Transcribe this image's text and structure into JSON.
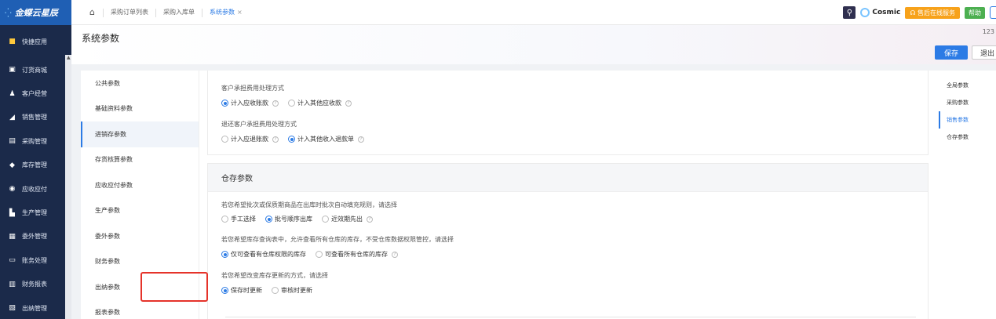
{
  "app": {
    "logo_text": "金蝶云星辰"
  },
  "tabs": [
    {
      "label": "采购订单列表"
    },
    {
      "label": "采购入库单"
    },
    {
      "label": "系统参数"
    }
  ],
  "top_right": {
    "cosmic_label": "Cosmic",
    "service_label": "售后在线服务",
    "help_label": "帮助"
  },
  "sidebar": {
    "items": [
      {
        "label": "快捷应用",
        "icon": "grid-icon"
      },
      {
        "label": "订货商城",
        "icon": "bag-icon"
      },
      {
        "label": "客户经营",
        "icon": "customers-icon"
      },
      {
        "label": "销售管理",
        "icon": "sales-icon"
      },
      {
        "label": "采购管理",
        "icon": "cart-icon"
      },
      {
        "label": "库存管理",
        "icon": "cube-icon"
      },
      {
        "label": "应收应付",
        "icon": "receivable-icon"
      },
      {
        "label": "生产管理",
        "icon": "factory-icon"
      },
      {
        "label": "委外管理",
        "icon": "outsource-icon"
      },
      {
        "label": "账务处理",
        "icon": "ledger-icon"
      },
      {
        "label": "财务报表",
        "icon": "report-icon"
      },
      {
        "label": "出纳管理",
        "icon": "cashier-icon"
      }
    ]
  },
  "header": {
    "title": "系统参数",
    "page_num": "123",
    "save_label": "保存",
    "exit_label": "退出"
  },
  "left_nav": {
    "items": [
      {
        "label": "公共参数"
      },
      {
        "label": "基础资料参数"
      },
      {
        "label": "进销存参数",
        "active": true
      },
      {
        "label": "存货核算参数"
      },
      {
        "label": "应收应付参数"
      },
      {
        "label": "生产参数"
      },
      {
        "label": "委外参数"
      },
      {
        "label": "财务参数"
      },
      {
        "label": "出纳参数"
      },
      {
        "label": "报表参数"
      }
    ]
  },
  "section1": {
    "q1": {
      "label": "客户承担费用处理方式",
      "opt_a": "计入应收账款",
      "opt_b": "计入其他应收款",
      "selected": "opt_a"
    },
    "q2": {
      "label": "退还客户承担费用处理方式",
      "opt_a": "计入应退账款",
      "opt_b": "计入其他收入退款单",
      "selected": "opt_b"
    }
  },
  "section2": {
    "title": "仓存参数",
    "q1": {
      "label": "若您希望批次或保质期商品在出库时批次自动填充规则，请选择",
      "opt_a": "手工选择",
      "opt_b": "批号顺序出库",
      "opt_c": "近效期先出",
      "selected": "opt_b"
    },
    "q2": {
      "label": "若您希望库存查询表中，允许查看所有仓库的库存，不受仓库数据权限管控，请选择",
      "opt_a": "仅可查看有仓库权限的库存",
      "opt_b": "可查看所有仓库的库存",
      "selected": "opt_a"
    },
    "q3": {
      "label": "若您希望改变库存更新的方式，请选择",
      "opt_a": "保存时更新",
      "opt_b": "审核时更新",
      "selected": "opt_a"
    }
  },
  "anchor": {
    "items": [
      {
        "label": "全局参数"
      },
      {
        "label": "采购参数"
      },
      {
        "label": "销售参数",
        "active": true
      },
      {
        "label": "仓存参数"
      }
    ]
  },
  "colors": {
    "primary": "#2c7be5",
    "sidebar_bg": "#1b2a4a",
    "highlight": "#e5332a",
    "service": "#f7a21b",
    "help": "#4caf50"
  }
}
